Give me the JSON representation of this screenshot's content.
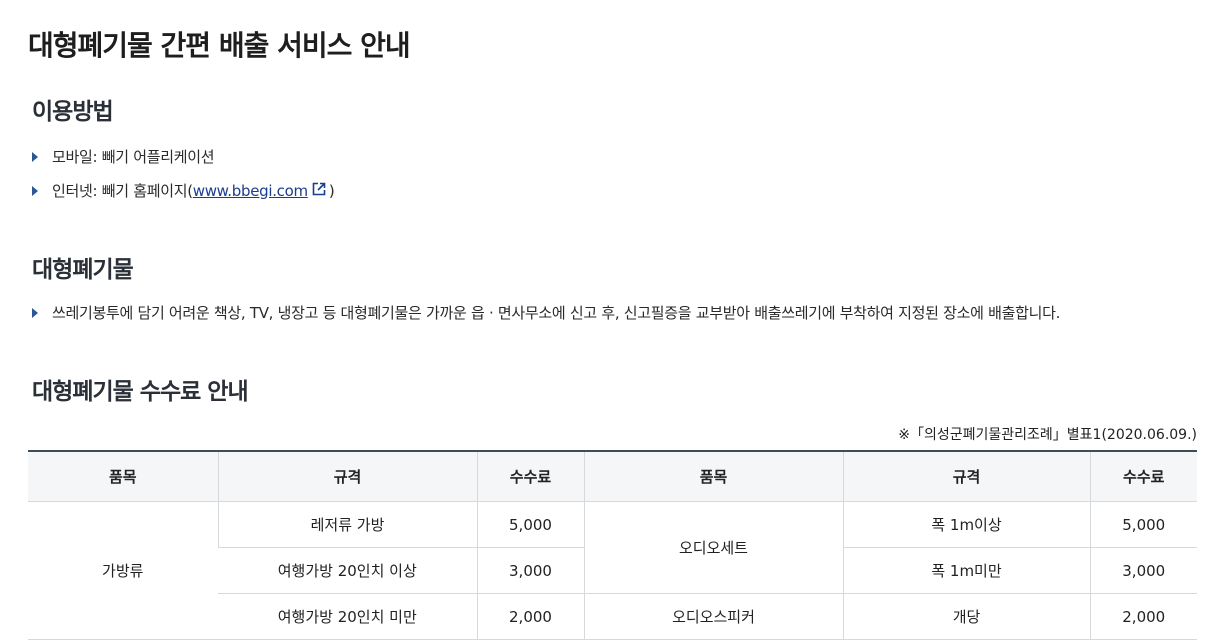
{
  "page_title": "대형폐기물 간편 배출 서비스 안내",
  "usage": {
    "title": "이용방법",
    "mobile": "모바일: 빼기 어플리케이션",
    "internet_prefix": "인터넷: 빼기 홈페이지(",
    "internet_link": "www.bbegi.com",
    "internet_suffix": ")",
    "link_icon": "external-link-icon"
  },
  "bulky": {
    "title": "대형폐기물",
    "description": "쓰레기봉투에 담기 어려운 책상, TV, 냉장고 등 대형폐기물은 가까운 읍 · 면사무소에 신고 후, 신고필증을 교부받아 배출쓰레기에 부착하여 지정된 장소에 배출합니다."
  },
  "fee_guide": {
    "title": "대형폐기물 수수료 안내",
    "source_note": "※「의성군폐기물관리조례」별표1(2020.06.09.)",
    "headers": [
      "품목",
      "규격",
      "수수료",
      "품목",
      "규격",
      "수수료"
    ],
    "left_group": "가방류",
    "left_rows": [
      {
        "spec": "레저류 가방",
        "fee": "5,000"
      },
      {
        "spec": "여행가방 20인치 이상",
        "fee": "3,000"
      },
      {
        "spec": "여행가방 20인치 미만",
        "fee": "2,000"
      }
    ],
    "audio_set": {
      "item": "오디오세트",
      "rows": [
        {
          "spec": "폭 1m이상",
          "fee": "5,000"
        },
        {
          "spec": "폭 1m미만",
          "fee": "3,000"
        }
      ]
    },
    "speaker": {
      "item": "오디오스피커",
      "spec": "개당",
      "fee": "2,000"
    }
  },
  "colors": {
    "bullet": "#2b5793",
    "link": "#1a3d8f",
    "table_header_bg": "#f4f6f8"
  }
}
